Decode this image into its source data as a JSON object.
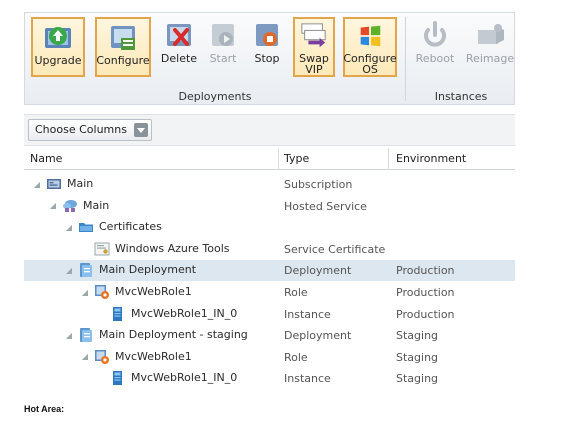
{
  "ribbon": {
    "buttons": [
      {
        "label": "Upgrade",
        "icon": "upgrade-icon",
        "state": "selected"
      },
      {
        "label": "Configure",
        "icon": "configure-icon",
        "state": "selected"
      },
      {
        "label": "Delete",
        "icon": "delete-icon",
        "state": "normal"
      },
      {
        "label": "Start",
        "icon": "start-icon",
        "state": "disabled"
      },
      {
        "label": "Stop",
        "icon": "stop-icon",
        "state": "normal"
      },
      {
        "label": "Swap\nVIP",
        "icon": "swap-vip-icon",
        "state": "selected"
      },
      {
        "label": "Configure\nOS",
        "icon": "configure-os-icon",
        "state": "selected"
      },
      {
        "label": "Reboot",
        "icon": "reboot-icon",
        "state": "disabled"
      },
      {
        "label": "Reimage",
        "icon": "reimage-icon",
        "state": "disabled"
      }
    ],
    "groups": [
      {
        "label": "Deployments"
      },
      {
        "label": "Instances"
      }
    ]
  },
  "toolbar": {
    "choose_columns_label": "Choose Columns"
  },
  "grid": {
    "headers": [
      "Name",
      "Type",
      "Environment"
    ],
    "rows": [
      {
        "name": "Main",
        "type": "Subscription",
        "env": "",
        "icon": "subscription-icon",
        "level": 0,
        "selected": false
      },
      {
        "name": "Main",
        "type": "Hosted Service",
        "env": "",
        "icon": "hosted-service-icon",
        "level": 1,
        "selected": false
      },
      {
        "name": "Certificates",
        "type": "",
        "env": "",
        "icon": "folder-icon",
        "level": 2,
        "selected": false
      },
      {
        "name": "Windows Azure Tools",
        "type": "Service Certificate",
        "env": "",
        "icon": "certificate-icon",
        "level": 3,
        "selected": false
      },
      {
        "name": "Main Deployment",
        "type": "Deployment",
        "env": "Production",
        "icon": "deployment-icon",
        "level": 2,
        "selected": true
      },
      {
        "name": "MvcWebRole1",
        "type": "Role",
        "env": "Production",
        "icon": "role-icon",
        "level": 3,
        "selected": false
      },
      {
        "name": "MvcWebRole1_IN_0",
        "type": "Instance",
        "env": "Production",
        "icon": "instance-icon",
        "level": 4,
        "selected": false
      },
      {
        "name": "Main Deployment - staging",
        "type": "Deployment",
        "env": "Staging",
        "icon": "deployment-icon",
        "level": 2,
        "selected": false
      },
      {
        "name": "MvcWebRole1",
        "type": "Role",
        "env": "Staging",
        "icon": "role-icon",
        "level": 3,
        "selected": false
      },
      {
        "name": "MvcWebRole1_IN_0",
        "type": "Instance",
        "env": "Staging",
        "icon": "instance-icon",
        "level": 4,
        "selected": false
      }
    ]
  },
  "footer": {
    "label": "Hot Area:"
  }
}
